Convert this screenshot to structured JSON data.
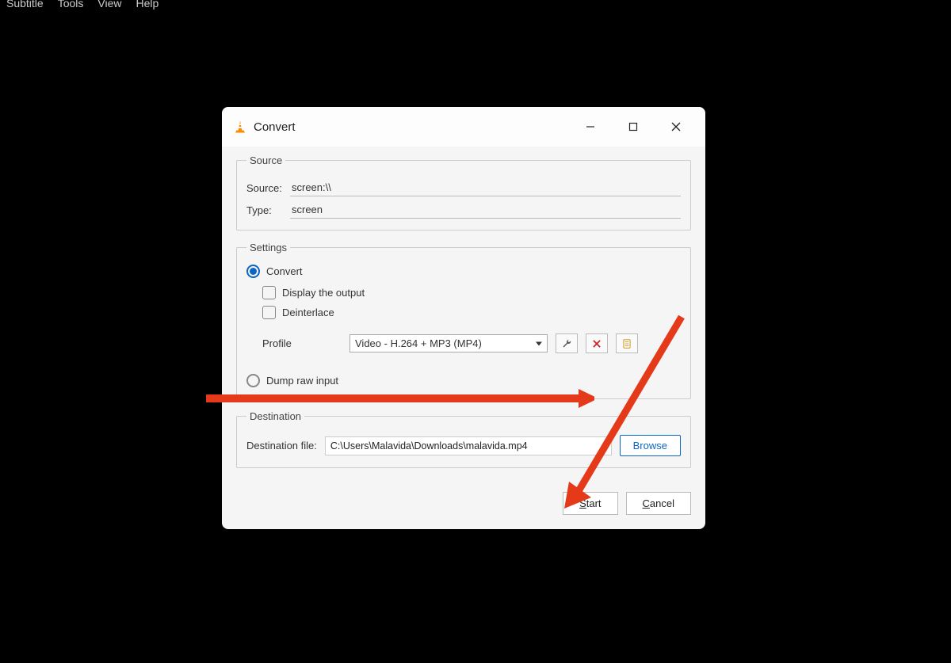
{
  "menubar": {
    "subtitle": "Subtitle",
    "tools": "Tools",
    "view": "View",
    "help": "Help"
  },
  "dialog": {
    "title": "Convert",
    "source": {
      "legend": "Source",
      "source_label": "Source:",
      "source_value": "screen:\\\\",
      "type_label": "Type:",
      "type_value": "screen"
    },
    "settings": {
      "legend": "Settings",
      "convert_label": "Convert",
      "display_output_label": "Display the output",
      "deinterlace_label": "Deinterlace",
      "profile_label": "Profile",
      "profile_value": "Video - H.264 + MP3 (MP4)",
      "dump_raw_label": "Dump raw input"
    },
    "destination": {
      "legend": "Destination",
      "dest_file_label": "Destination file:",
      "dest_file_value": "C:\\Users\\Malavida\\Downloads\\malavida.mp4",
      "browse_label": "Browse"
    },
    "footer": {
      "start_prefix": "S",
      "start_rest": "tart",
      "cancel_prefix": "C",
      "cancel_rest": "ancel"
    }
  }
}
